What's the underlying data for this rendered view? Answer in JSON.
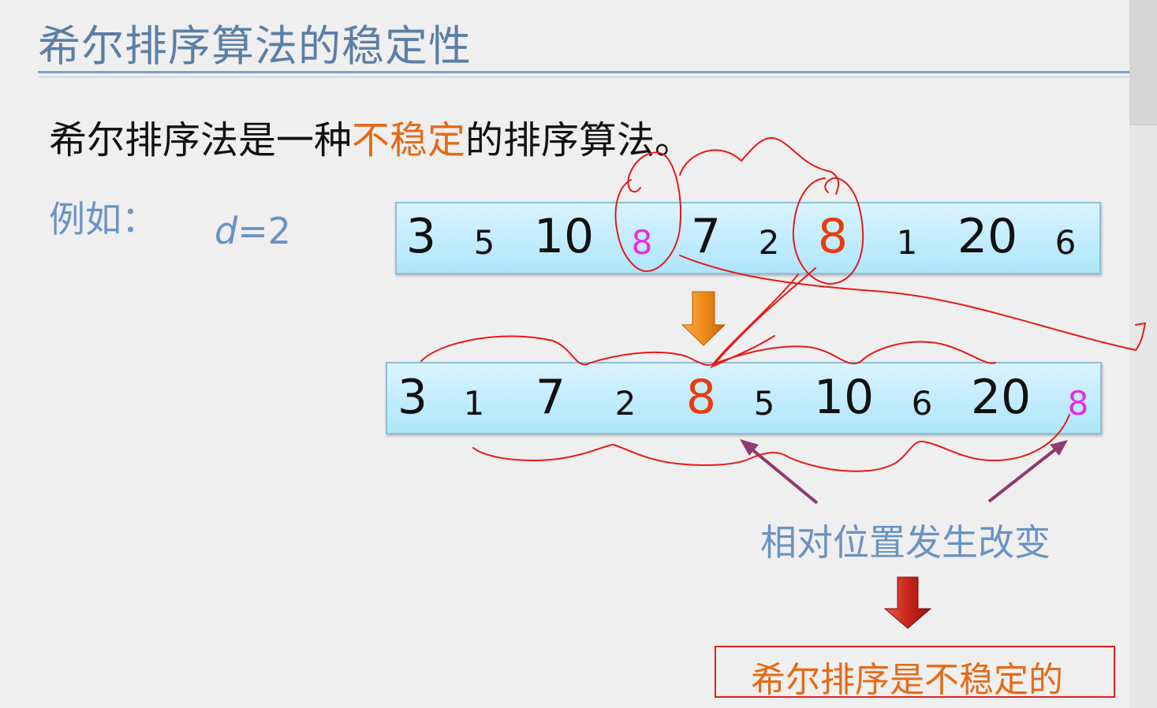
{
  "slide": {
    "title": "希尔排序算法的稳定性",
    "statement_before": "希尔排序法是一种",
    "statement_highlight": "不稳定",
    "statement_after": "的排序算法。",
    "example_label": "例如：",
    "d_var": "d",
    "d_eq": "=2",
    "row1": [
      "3",
      "5",
      "10",
      "8",
      "7",
      "2",
      "8",
      "1",
      "20",
      "6"
    ],
    "row2": [
      "3",
      "1",
      "7",
      "2",
      "8",
      "5",
      "10",
      "6",
      "20",
      "8"
    ],
    "caption": "相对位置发生改变",
    "conclusion": "希尔排序是不稳定的"
  },
  "colors": {
    "title": "#5b7ea6",
    "accent": "#e46b17",
    "pink": "#e52ce5",
    "red_digit": "#ea3c10",
    "annotation": "#e02020",
    "box_fill": "#bfeefe"
  },
  "icons": [
    "orange-down-arrow-icon",
    "red-down-arrow-icon",
    "purple-pointer-arrow-icon"
  ]
}
